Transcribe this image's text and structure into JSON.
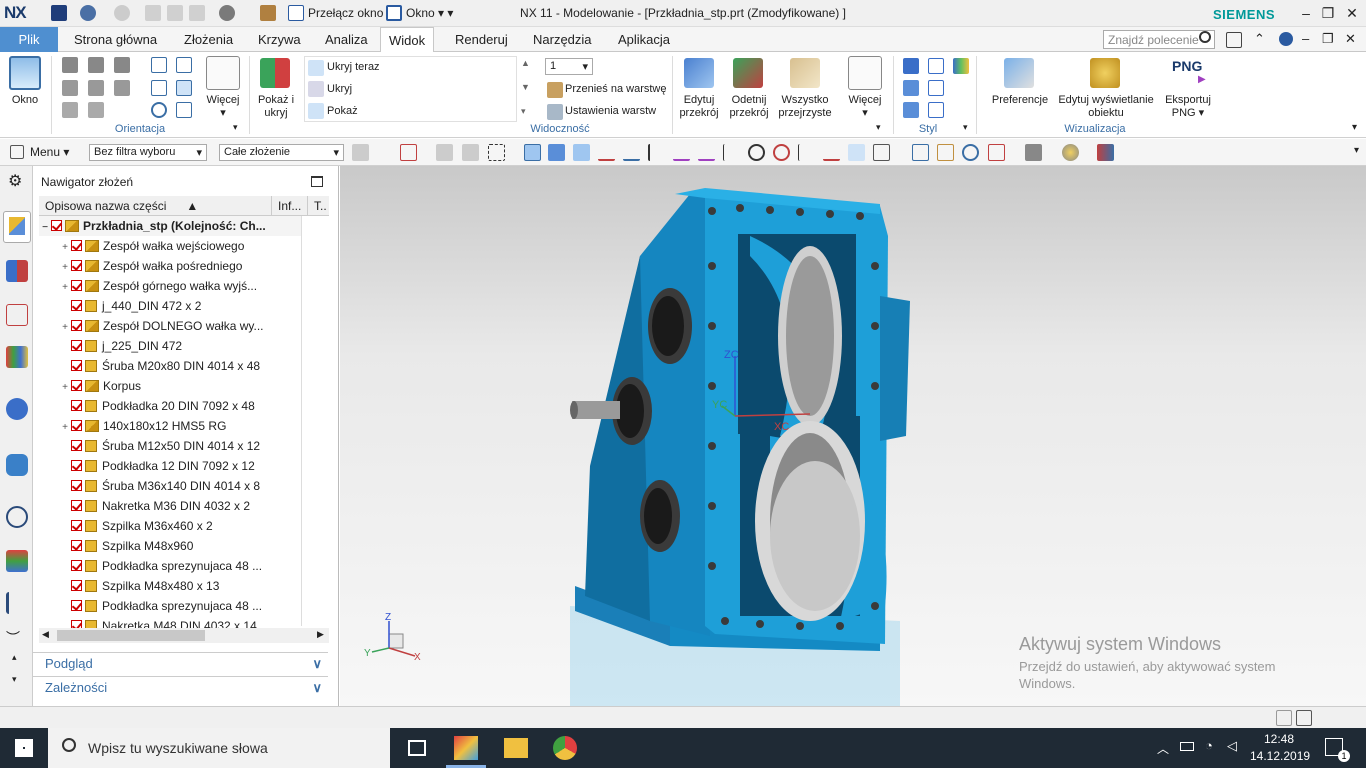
{
  "titlebar": {
    "logo": "NX",
    "switch_window": "Przełącz okno",
    "window_menu": "Okno",
    "title": "NX 11 - Modelowanie - [Przkładnia_stp.prt (Zmodyfikowane) ]",
    "brand": "SIEMENS"
  },
  "tabs": {
    "file": "Plik",
    "items": [
      "Strona główna",
      "Złożenia",
      "Krzywa",
      "Analiza",
      "Widok",
      "Renderuj",
      "Narzędzia",
      "Aplikacja"
    ],
    "active": "Widok",
    "search_placeholder": "Znajdź polecenie"
  },
  "ribbon": {
    "window_btn": "Okno",
    "orientation_label": "Orientacja",
    "more_btn": "Więcej",
    "show_hide_btn": "Pokaż i ukryj",
    "hide_now": "Ukryj teraz",
    "hide": "Ukryj",
    "show": "Pokaż",
    "layer_value": "1",
    "move_to_layer": "Przenieś na warstwę",
    "layer_settings": "Ustawienia warstw",
    "visibility_label": "Widoczność",
    "edit_section": "Edytuj przekrój",
    "clip_section": "Odetnij przekrój",
    "all_transparent": "Wszystko przejrzyste",
    "more_btn2": "Więcej",
    "style_label": "Styl",
    "preferences": "Preferencje",
    "edit_object_display": "Edytuj wyświetlanie obiektu",
    "export_png_icon": "PNG",
    "export_png": "Eksportuj PNG",
    "visualization_label": "Wizualizacja"
  },
  "toolbar": {
    "menu": "Menu",
    "filter": "Bez filtra wyboru",
    "scope": "Całe złożenie"
  },
  "navigator": {
    "title": "Nawigator złożeń",
    "col_name": "Opisowa nazwa części",
    "col_info": "Inf...",
    "col_t": "T..",
    "root": "Przkładnia_stp (Kolejność: Ch...",
    "rows": [
      {
        "label": "Zespół wałka wejściowego",
        "type": "asm",
        "exp": "+"
      },
      {
        "label": "Zespół wałka pośredniego",
        "type": "asm",
        "exp": "+"
      },
      {
        "label": "Zespół górnego wałka wyjś...",
        "type": "asm",
        "exp": "+"
      },
      {
        "label": "j_440_DIN 472 x 2",
        "type": "part",
        "exp": ""
      },
      {
        "label": "Zespół DOLNEGO wałka wy...",
        "type": "asm",
        "exp": "+"
      },
      {
        "label": "j_225_DIN 472",
        "type": "part",
        "exp": ""
      },
      {
        "label": "Śruba M20x80 DIN 4014 x 48",
        "type": "part",
        "exp": ""
      },
      {
        "label": "Korpus",
        "type": "asm",
        "exp": "+"
      },
      {
        "label": "Podkładka 20 DIN 7092 x 48",
        "type": "part",
        "exp": ""
      },
      {
        "label": "140x180x12 HMS5 RG",
        "type": "asm",
        "exp": "+"
      },
      {
        "label": "Śruba M12x50 DIN 4014 x 12",
        "type": "part",
        "exp": ""
      },
      {
        "label": "Podkładka 12 DIN 7092 x 12",
        "type": "part",
        "exp": ""
      },
      {
        "label": "Śruba M36x140 DIN 4014 x 8",
        "type": "part",
        "exp": ""
      },
      {
        "label": "Nakretka M36 DIN 4032 x 2",
        "type": "part",
        "exp": ""
      },
      {
        "label": "Szpilka M36x460 x 2",
        "type": "part",
        "exp": ""
      },
      {
        "label": "Szpilka M48x960",
        "type": "part",
        "exp": ""
      },
      {
        "label": "Podkładka sprezynujaca 48 ...",
        "type": "part",
        "exp": ""
      },
      {
        "label": "Szpilka M48x480 x 13",
        "type": "part",
        "exp": ""
      },
      {
        "label": "Podkładka sprezynujaca 48 ...",
        "type": "part",
        "exp": ""
      },
      {
        "label": "Nakretka M48 DIN 4032 x 14",
        "type": "part",
        "exp": ""
      }
    ],
    "preview": "Podgląd",
    "dependencies": "Zależności"
  },
  "viewport": {
    "axis_z": "Z",
    "axis_y": "Y",
    "axis_x": "X",
    "wcs_z": "ZC",
    "wcs_y": "YC",
    "wcs_x": "XC",
    "watermark_title": "Aktywuj system Windows",
    "watermark_text": "Przejdź do ustawień, aby aktywować system Windows."
  },
  "taskbar": {
    "search": "Wpisz tu wyszukiwane słowa",
    "time": "12:48",
    "date": "14.12.2019",
    "notifications": "1"
  },
  "colors": {
    "accent": "#4f8fd0",
    "model": "#1e9fd8",
    "brand": "#009999"
  }
}
